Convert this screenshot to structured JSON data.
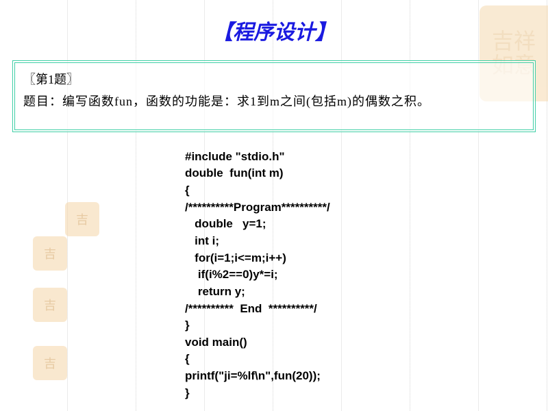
{
  "title": "【程序设计】",
  "problem": {
    "number": "〖第1题〗",
    "text": "题目：编写函数fun，函数的功能是：求1到m之间(包括m)的偶数之积。"
  },
  "code": {
    "lines": [
      "#include \"stdio.h\"",
      "double  fun(int m)",
      "{",
      "/**********Program**********/",
      "   double   y=1;",
      "   int i;",
      "   for(i=1;i<=m;i++)",
      "    if(i%2==0)y*=i;",
      "    return y;",
      "/**********  End  **********/",
      "}",
      "void main()",
      "{",
      "printf(\"ji=%lf\\n\",fun(20));",
      "}"
    ]
  },
  "decor": {
    "sealSmall": "吉",
    "sealLarge1": "吉祥",
    "sealLarge2": "如意"
  }
}
